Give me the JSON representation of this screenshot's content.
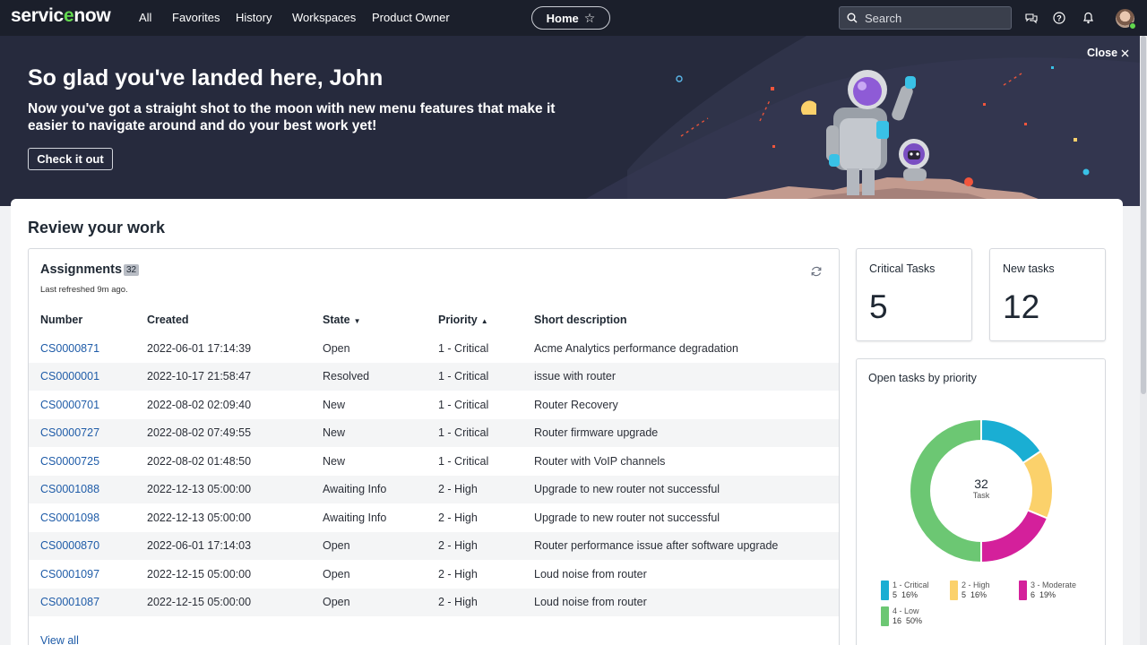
{
  "nav": {
    "logo": "servicenow",
    "links": [
      "All",
      "Favorites",
      "History",
      "Workspaces",
      "Product Owner"
    ],
    "home_label": "Home",
    "search_placeholder": "Search"
  },
  "hero": {
    "heading": "So glad you've landed here, John",
    "body": "Now you've got a straight shot to the moon with new menu features that make it easier to navigate around and do your best work yet!",
    "cta_label": "Check it out",
    "close_label": "Close"
  },
  "review": {
    "title": "Review your work"
  },
  "assignments": {
    "title": "Assignments",
    "count": "32",
    "last_refreshed": "Last refreshed 9m ago.",
    "columns": [
      "Number",
      "Created",
      "State",
      "Priority",
      "Short description"
    ],
    "rows": [
      [
        "CS0000871",
        "2022-06-01 17:14:39",
        "Open",
        "1 - Critical",
        "Acme Analytics performance degradation"
      ],
      [
        "CS0000001",
        "2022-10-17 21:58:47",
        "Resolved",
        "1 - Critical",
        "issue with router"
      ],
      [
        "CS0000701",
        "2022-08-02 02:09:40",
        "New",
        "1 - Critical",
        "Router Recovery"
      ],
      [
        "CS0000727",
        "2022-08-02 07:49:55",
        "New",
        "1 - Critical",
        "Router firmware upgrade"
      ],
      [
        "CS0000725",
        "2022-08-02 01:48:50",
        "New",
        "1 - Critical",
        "Router with VoIP channels"
      ],
      [
        "CS0001088",
        "2022-12-13 05:00:00",
        "Awaiting Info",
        "2 - High",
        "Upgrade to new router not successful"
      ],
      [
        "CS0001098",
        "2022-12-13 05:00:00",
        "Awaiting Info",
        "2 - High",
        "Upgrade to new router not successful"
      ],
      [
        "CS0000870",
        "2022-06-01 17:14:03",
        "Open",
        "2 - High",
        "Router performance issue after software upgrade"
      ],
      [
        "CS0001097",
        "2022-12-15 05:00:00",
        "Open",
        "2 - High",
        "Loud noise from router"
      ],
      [
        "CS0001087",
        "2022-12-15 05:00:00",
        "Open",
        "2 - High",
        "Loud noise from router"
      ]
    ],
    "view_all": "View all"
  },
  "kpis": {
    "critical_label": "Critical Tasks",
    "critical_value": "5",
    "new_label": "New tasks",
    "new_value": "12"
  },
  "donut": {
    "title": "Open tasks by priority",
    "center_value": "32",
    "center_label": "Task"
  },
  "chart_data": {
    "type": "pie",
    "title": "Open tasks by priority",
    "total": 32,
    "series": [
      {
        "name": "1 - Critical",
        "value": 5,
        "percent": "16%",
        "color": "#1aaed3"
      },
      {
        "name": "2 - High",
        "value": 5,
        "percent": "16%",
        "color": "#fbd16b"
      },
      {
        "name": "3 - Moderate",
        "value": 6,
        "percent": "19%",
        "color": "#d4209b"
      },
      {
        "name": "4 - Low",
        "value": 16,
        "percent": "50%",
        "color": "#6cc773"
      }
    ]
  }
}
